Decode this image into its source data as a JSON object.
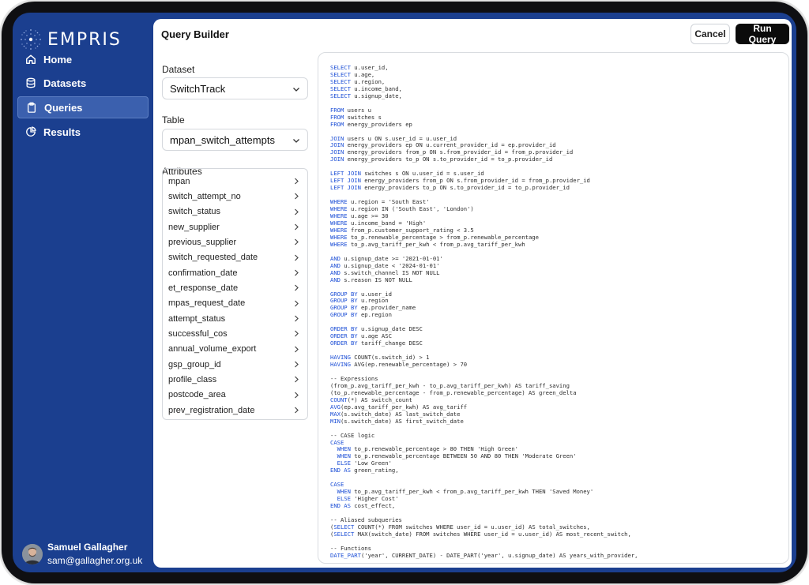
{
  "app": {
    "name": "EMPRIS"
  },
  "nav": [
    {
      "label": "Home",
      "icon": "home-icon",
      "active": false
    },
    {
      "label": "Datasets",
      "icon": "database-icon",
      "active": false
    },
    {
      "label": "Queries",
      "icon": "clipboard-icon",
      "active": true
    },
    {
      "label": "Results",
      "icon": "pie-chart-icon",
      "active": false
    }
  ],
  "user": {
    "name": "Samuel Gallagher",
    "email": "sam@gallagher.org.uk"
  },
  "header": {
    "title": "Query Builder",
    "cancel_label": "Cancel",
    "run_label": "Run Query"
  },
  "dataset": {
    "label": "Dataset",
    "value": "SwitchTrack"
  },
  "table": {
    "label": "Table",
    "value": "mpan_switch_attempts"
  },
  "attributes": {
    "label": "Attributes",
    "items": [
      "mpan",
      "switch_attempt_no",
      "switch_status",
      "new_supplier",
      "previous_supplier",
      "switch_requested_date",
      "confirmation_date",
      "et_response_date",
      "mpas_request_date",
      "attempt_status",
      "successful_cos",
      "annual_volume_export",
      "gsp_group_id",
      "profile_class",
      "postcode_area",
      "prev_registration_date"
    ]
  },
  "sql": [
    "SELECT u.user_id,",
    "SELECT u.age,",
    "SELECT u.region,",
    "SELECT u.income_band,",
    "SELECT u.signup_date,",
    "",
    "FROM users u",
    "FROM switches s",
    "FROM energy_providers ep",
    "",
    "JOIN users u ON s.user_id = u.user_id",
    "JOIN energy_providers ep ON u.current_provider_id = ep.provider_id",
    "JOIN energy_providers from_p ON s.from_provider_id = from_p.provider_id",
    "JOIN energy_providers to_p ON s.to_provider_id = to_p.provider_id",
    "",
    "LEFT JOIN switches s ON u.user_id = s.user_id",
    "LEFT JOIN energy_providers from_p ON s.from_provider_id = from_p.provider_id",
    "LEFT JOIN energy_providers to_p ON s.to_provider_id = to_p.provider_id",
    "",
    "WHERE u.region = 'South East'",
    "WHERE u.region IN ('South East', 'London')",
    "WHERE u.age >= 30",
    "WHERE u.income_band = 'High'",
    "WHERE from_p.customer_support_rating < 3.5",
    "WHERE to_p.renewable_percentage > from_p.renewable_percentage",
    "WHERE to_p.avg_tariff_per_kwh < from_p.avg_tariff_per_kwh",
    "",
    "AND u.signup_date >= '2021-01-01'",
    "AND u.signup_date < '2024-01-01'",
    "AND s.switch_channel IS NOT NULL",
    "AND s.reason IS NOT NULL",
    "",
    "GROUP BY u.user_id",
    "GROUP BY u.region",
    "GROUP BY ep.provider_name",
    "GROUP BY ep.region",
    "",
    "ORDER BY u.signup_date DESC",
    "ORDER BY u.age ASC",
    "ORDER BY tariff_change DESC",
    "",
    "HAVING COUNT(s.switch_id) > 1",
    "HAVING AVG(ep.renewable_percentage) > 70",
    "",
    "-- Expressions",
    "(from_p.avg_tariff_per_kwh - to_p.avg_tariff_per_kwh) AS tariff_saving",
    "(to_p.renewable_percentage - from_p.renewable_percentage) AS green_delta",
    "COUNT(*) AS switch_count",
    "AVG(ep.avg_tariff_per_kwh) AS avg_tariff",
    "MAX(s.switch_date) AS last_switch_date",
    "MIN(s.switch_date) AS first_switch_date",
    "",
    "-- CASE logic",
    "CASE",
    "  WHEN to_p.renewable_percentage > 80 THEN 'High Green'",
    "  WHEN to_p.renewable_percentage BETWEEN 50 AND 80 THEN 'Moderate Green'",
    "  ELSE 'Low Green'",
    "END AS green_rating,",
    "",
    "CASE",
    "  WHEN to_p.avg_tariff_per_kwh < from_p.avg_tariff_per_kwh THEN 'Saved Money'",
    "  ELSE 'Higher Cost'",
    "END AS cost_effect,",
    "",
    "-- Aliased subqueries",
    "(SELECT COUNT(*) FROM switches WHERE user_id = u.user_id) AS total_switches,",
    "(SELECT MAX(switch_date) FROM switches WHERE user_id = u.user_id) AS most_recent_switch,",
    "",
    "-- Functions",
    "DATE_PART('year', CURRENT_DATE) - DATE_PART('year', u.signup_date) AS years_with_provider,"
  ],
  "colors": {
    "sidebar_bg": "#1b3f8f",
    "active_nav": "#3b60ae",
    "keyword": "#1d4fd6",
    "primary_button": "#0b0b0b"
  }
}
